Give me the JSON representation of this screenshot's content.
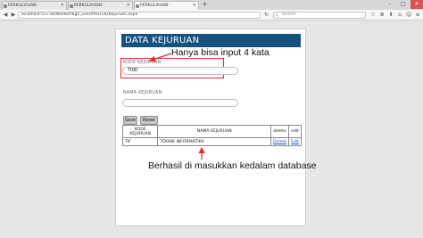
{
  "browser": {
    "tabs": [
      {
        "label": "PERKULIAHAN :"
      },
      {
        "label": "PERKULIAHAN :"
      },
      {
        "label": "PERKULIAHAN :"
      }
    ],
    "new_tab": "+",
    "url": "localhost:55734/MasterPage_user/POLTEK/Kejuruan.aspx",
    "search_placeholder": "Search",
    "window_controls": {
      "minimize": "–",
      "maximize": "□",
      "close": "✕"
    },
    "icons": [
      "back-icon",
      "forward-icon",
      "reload-icon",
      "search-icon",
      "bookmark-star-icon",
      "download-icon",
      "home-icon",
      "menu-icon"
    ]
  },
  "form": {
    "title": "DATA KEJURUAN",
    "kode_label": "KODE KEJURUAN",
    "kode_value": "TIND",
    "nama_label": "NAMA KEJURUAN",
    "nama_value": "",
    "save_label": "Save",
    "reset_label": "Reset"
  },
  "table": {
    "headers": [
      "KODE KEJURUAN",
      "NAMA KEJURUAN",
      "delete",
      "edit"
    ],
    "rows": [
      {
        "kode": "TIF",
        "nama": "TEKNIK INFORMATIKA",
        "delete": "Delete",
        "edit": "Edit"
      }
    ]
  },
  "annotations": {
    "top_note": "Hanya bisa input 4 kata",
    "bottom_note": "Berhasil di masukkan kedalam database",
    "color": "#e03030"
  }
}
